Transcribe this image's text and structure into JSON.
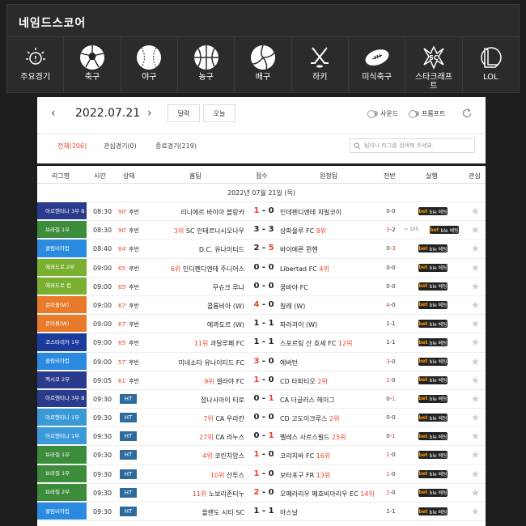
{
  "brand": "네임드스코어",
  "sports": [
    {
      "label": "주요경기",
      "icon": "lightbulb-icon"
    },
    {
      "label": "축구",
      "icon": "soccer-ball-icon"
    },
    {
      "label": "야구",
      "icon": "baseball-icon"
    },
    {
      "label": "농구",
      "icon": "basketball-icon"
    },
    {
      "label": "배구",
      "icon": "volleyball-icon"
    },
    {
      "label": "하키",
      "icon": "hockey-sticks-icon"
    },
    {
      "label": "미식축구",
      "icon": "american-football-icon"
    },
    {
      "label": "스타크래프트",
      "icon": "starcraft-logo-icon"
    },
    {
      "label": "LOL",
      "icon": "lol-logo-icon"
    }
  ],
  "datebar": {
    "prev": "‹",
    "date": "2022.07.21",
    "next": "›",
    "calendar_label": "달력",
    "today_label": "오늘",
    "sound_label": "사운드",
    "promotion_label": "프롬프트"
  },
  "tabs": [
    {
      "label": "전체(206)",
      "active": true
    },
    {
      "label": "관심경기(0)",
      "active": false
    },
    {
      "label": "종료경기(219)",
      "active": false
    }
  ],
  "search": {
    "placeholder": "팀이나 리그를 검색해 주세요."
  },
  "headers": {
    "league": "리그명",
    "time": "시간",
    "status": "상태",
    "home": "홈팀",
    "score": "점수",
    "away": "원정팀",
    "half": "전반",
    "live": "실행",
    "fav": "관심"
  },
  "day_label": "2022년 07월 21일 (목)",
  "colors": {
    "navy": "#2a3a8c",
    "green": "#3c8c3c",
    "blue": "#2a8ae0",
    "sky": "#3a9ad8",
    "lime": "#7ab030",
    "orange": "#e87a2a",
    "darkblue": "#1a3a9c"
  },
  "matches": [
    {
      "league": "아르헨티나 3부 B",
      "color": "navy",
      "time": "08:30",
      "min": "90'",
      "state": "후반",
      "home_rank": "",
      "home": "리니에르 바이아 블랑카",
      "hs": "1",
      "as": "0",
      "away": "인데펜디엔테 치빌코이",
      "away_rank": "",
      "h1": "0",
      "h2": "0",
      "bet": "one",
      "live_n": ""
    },
    {
      "league": "브라질 1부",
      "color": "green",
      "time": "08:30",
      "min": "90'",
      "state": "후반",
      "home_rank": "3위",
      "home": "SC 인테르나시오나우",
      "hs": "3",
      "as": "3",
      "away": "상파울루 FC",
      "away_rank": "8위",
      "h1": "3",
      "h2": "2",
      "bet": "two",
      "live_n": "105"
    },
    {
      "league": "콜럼비아컵",
      "color": "blue",
      "time": "08:40",
      "min": "84'",
      "state": "후반",
      "home_rank": "",
      "home": "D.C. 유나이티드",
      "hs": "2",
      "as": "5",
      "away": "바이에른 뮌헨",
      "away_rank": "",
      "h1": "0",
      "h2": "3",
      "bet": "one",
      "live_n": ""
    },
    {
      "league": "에콰도르 2부",
      "color": "lime",
      "time": "09:00",
      "min": "65'",
      "state": "후반",
      "home_rank": "6위",
      "home": "인디펜디엔테 주니어스",
      "hs": "0",
      "as": "0",
      "away": "Libertad FC",
      "away_rank": "4위",
      "h1": "0",
      "h2": "0",
      "bet": "one",
      "live_n": ""
    },
    {
      "league": "에콰도르 컵",
      "color": "lime",
      "time": "09:00",
      "min": "65'",
      "state": "후반",
      "home_rank": "",
      "home": "무슈크 루나",
      "hs": "0",
      "as": "0",
      "away": "쿰바야 FC",
      "away_rank": "",
      "h1": "0",
      "h2": "0",
      "bet": "one",
      "live_n": ""
    },
    {
      "league": "콘미볼(W)",
      "color": "orange",
      "time": "09:00",
      "min": "67'",
      "state": "후반",
      "home_rank": "",
      "home": "콜롬비아 (W)",
      "hs": "4",
      "as": "0",
      "away": "칠레 (W)",
      "away_rank": "",
      "h1": "4",
      "h2": "0",
      "bet": "one",
      "live_n": ""
    },
    {
      "league": "콘미볼(W)",
      "color": "orange",
      "time": "09:00",
      "min": "67'",
      "state": "후반",
      "home_rank": "",
      "home": "에콰도르 (W)",
      "hs": "1",
      "as": "1",
      "away": "파라과이 (W)",
      "away_rank": "",
      "h1": "1",
      "h2": "1",
      "bet": "one",
      "live_n": ""
    },
    {
      "league": "코스타리카 1부",
      "color": "darkblue",
      "time": "09:00",
      "min": "65'",
      "state": "후반",
      "home_rank": "11위",
      "home": "과달루페 FC",
      "hs": "1",
      "as": "1",
      "away": "스포르팅 산 호세 FC",
      "away_rank": "12위",
      "h1": "1",
      "h2": "1",
      "bet": "one",
      "live_n": ""
    },
    {
      "league": "콜럼비아컵",
      "color": "blue",
      "time": "09:00",
      "min": "57'",
      "state": "후반",
      "home_rank": "",
      "home": "미네소타 유나이티드 FC",
      "hs": "3",
      "as": "0",
      "away": "에버턴",
      "away_rank": "",
      "h1": "3",
      "h2": "0",
      "bet": "one",
      "live_n": ""
    },
    {
      "league": "멕시코 2부",
      "color": "navy",
      "time": "09:05",
      "min": "61'",
      "state": "후반",
      "home_rank": "9위",
      "home": "셀라야 FC",
      "hs": "1",
      "as": "0",
      "away": "CD 타파티오",
      "away_rank": "2위",
      "h1": "1",
      "h2": "0",
      "bet": "one",
      "live_n": ""
    },
    {
      "league": "아르헨티나 3부 B",
      "color": "navy",
      "time": "09:30",
      "min": "",
      "state": "HT",
      "home_rank": "",
      "home": "접나시아이 티로",
      "hs": "0",
      "as": "1",
      "away": "CA 더글러스 헤이그",
      "away_rank": "",
      "h1": "0",
      "h2": "1",
      "bet": "one",
      "live_n": ""
    },
    {
      "league": "아르헨티나 1부",
      "color": "sky",
      "time": "09:30",
      "min": "",
      "state": "HT",
      "home_rank": "7위",
      "home": "CA 우라칸",
      "hs": "0",
      "as": "0",
      "away": "CD 고도이크루스",
      "away_rank": "2위",
      "h1": "0",
      "h2": "0",
      "bet": "one",
      "live_n": ""
    },
    {
      "league": "아르헨티나 1부",
      "color": "sky",
      "time": "09:30",
      "min": "",
      "state": "HT",
      "home_rank": "27위",
      "home": "CA 라누스",
      "hs": "0",
      "as": "1",
      "away": "벨레스 사르스필드",
      "away_rank": "25위",
      "h1": "0",
      "h2": "1",
      "bet": "one",
      "live_n": ""
    },
    {
      "league": "브라질 1부",
      "color": "green",
      "time": "09:30",
      "min": "",
      "state": "HT",
      "home_rank": "4위",
      "home": "코린치앙스",
      "hs": "1",
      "as": "0",
      "away": "코리치바 FC",
      "away_rank": "16위",
      "h1": "1",
      "h2": "0",
      "bet": "one",
      "live_n": ""
    },
    {
      "league": "브라질 1부",
      "color": "green",
      "time": "09:30",
      "min": "",
      "state": "HT",
      "home_rank": "10위",
      "home": "산투스",
      "hs": "1",
      "as": "0",
      "away": "보타포구 FR",
      "away_rank": "13위",
      "h1": "1",
      "h2": "0",
      "bet": "one",
      "live_n": ""
    },
    {
      "league": "브라질 2부",
      "color": "green",
      "time": "09:30",
      "min": "",
      "state": "HT",
      "home_rank": "11위",
      "home": "노보리존티누",
      "hs": "2",
      "as": "0",
      "away": "오페라리우 페호비아리우 EC",
      "away_rank": "14위",
      "h1": "2",
      "h2": "0",
      "bet": "one",
      "live_n": ""
    },
    {
      "league": "콜럼비아컵",
      "color": "blue",
      "time": "09:30",
      "min": "",
      "state": "HT",
      "home_rank": "",
      "home": "올랜도 시티 SC",
      "hs": "1",
      "as": "1",
      "away": "아스날",
      "away_rank": "",
      "h1": "1",
      "h2": "1",
      "bet": "one",
      "live_n": ""
    }
  ],
  "bet_logo": {
    "b": "bet",
    "rest": "ble 베팅"
  }
}
